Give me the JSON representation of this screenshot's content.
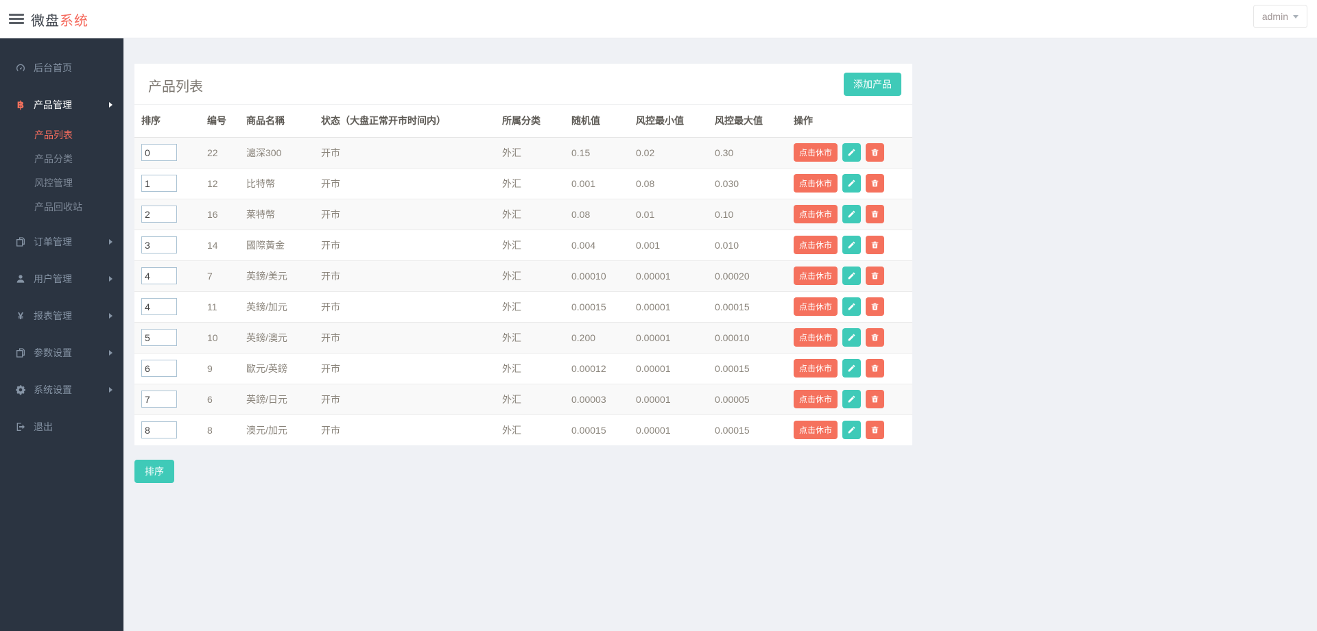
{
  "header": {
    "logo_primary": "微盘",
    "logo_accent": "系统",
    "user_menu_label": "admin"
  },
  "sidebar": {
    "items": [
      {
        "label": "后台首页",
        "icon": "dashboard-icon"
      },
      {
        "label": "产品管理",
        "icon": "bitcoin-icon",
        "children": [
          {
            "label": "产品列表"
          },
          {
            "label": "产品分类"
          },
          {
            "label": "风控管理"
          },
          {
            "label": "产品回收站"
          }
        ]
      },
      {
        "label": "订单管理",
        "icon": "orders-icon"
      },
      {
        "label": "用户管理",
        "icon": "user-icon"
      },
      {
        "label": "报表管理",
        "icon": "yen-icon"
      },
      {
        "label": "参数设置",
        "icon": "params-icon"
      },
      {
        "label": "系统设置",
        "icon": "gears-icon"
      },
      {
        "label": "退出",
        "icon": "logout-icon"
      }
    ],
    "bitcoin_glyph": "฿",
    "yen_glyph": "¥"
  },
  "main": {
    "card_title": "产品列表",
    "add_button_label": "添加产品",
    "sort_button_label": "排序",
    "table": {
      "headers": [
        "排序",
        "编号",
        "商品名稱",
        "状态（大盘正常开市时间内）",
        "所属分类",
        "随机值",
        "风控最小值",
        "风控最大值",
        "操作"
      ],
      "close_market_label": "点击休市",
      "rows": [
        {
          "sort": "0",
          "id": "22",
          "name": "滬深300",
          "status": "开市",
          "category": "外汇",
          "random": "0.15",
          "risk_min": "0.02",
          "risk_max": "0.30"
        },
        {
          "sort": "1",
          "id": "12",
          "name": "比特幣",
          "status": "开市",
          "category": "外汇",
          "random": "0.001",
          "risk_min": "0.08",
          "risk_max": "0.030"
        },
        {
          "sort": "2",
          "id": "16",
          "name": "莱特幣",
          "status": "开市",
          "category": "外汇",
          "random": "0.08",
          "risk_min": "0.01",
          "risk_max": "0.10"
        },
        {
          "sort": "3",
          "id": "14",
          "name": "國際黃金",
          "status": "开市",
          "category": "外汇",
          "random": "0.004",
          "risk_min": "0.001",
          "risk_max": "0.010"
        },
        {
          "sort": "4",
          "id": "7",
          "name": "英鎊/美元",
          "status": "开市",
          "category": "外汇",
          "random": "0.00010",
          "risk_min": "0.00001",
          "risk_max": "0.00020"
        },
        {
          "sort": "4",
          "id": "11",
          "name": "英鎊/加元",
          "status": "开市",
          "category": "外汇",
          "random": "0.00015",
          "risk_min": "0.00001",
          "risk_max": "0.00015"
        },
        {
          "sort": "5",
          "id": "10",
          "name": "英鎊/澳元",
          "status": "开市",
          "category": "外汇",
          "random": "0.200",
          "risk_min": "0.00001",
          "risk_max": "0.00010"
        },
        {
          "sort": "6",
          "id": "9",
          "name": "歐元/英鎊",
          "status": "开市",
          "category": "外汇",
          "random": "0.00012",
          "risk_min": "0.00001",
          "risk_max": "0.00015"
        },
        {
          "sort": "7",
          "id": "6",
          "name": "英鎊/日元",
          "status": "开市",
          "category": "外汇",
          "random": "0.00003",
          "risk_min": "0.00001",
          "risk_max": "0.00005"
        },
        {
          "sort": "8",
          "id": "8",
          "name": "澳元/加元",
          "status": "开市",
          "category": "外汇",
          "random": "0.00015",
          "risk_min": "0.00001",
          "risk_max": "0.00015"
        }
      ]
    }
  },
  "colors": {
    "accent_coral": "#f5715d",
    "accent_teal": "#3fcab8",
    "sidebar_bg": "#2b3441",
    "content_bg": "#eff1f5"
  }
}
